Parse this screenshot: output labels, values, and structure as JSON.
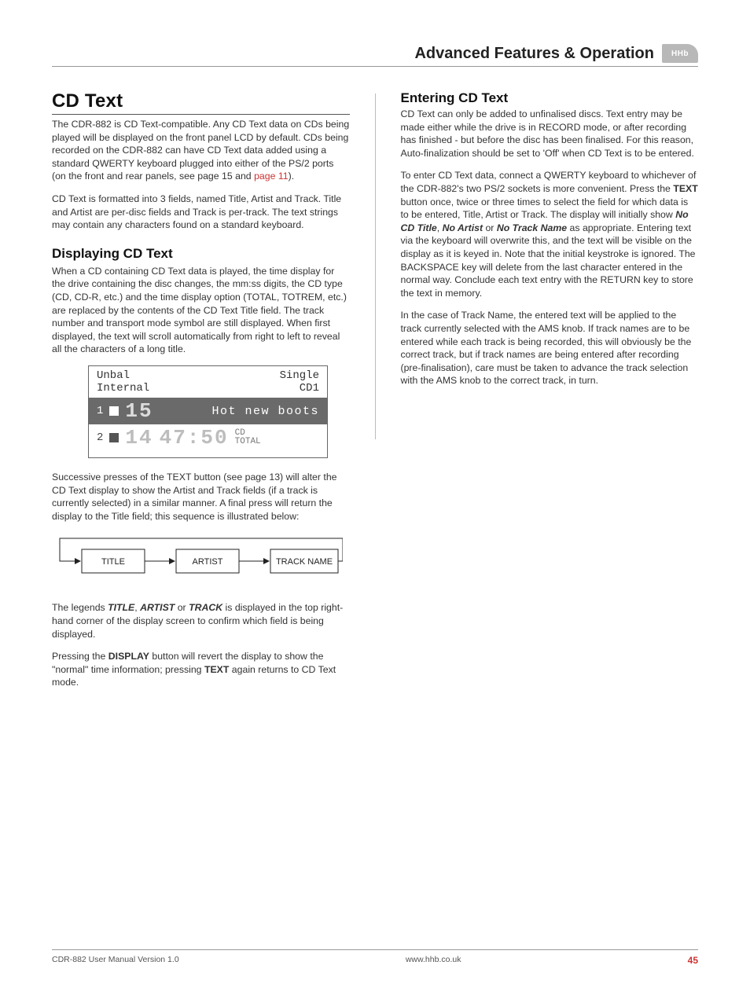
{
  "banner": {
    "title": "Advanced Features & Operation",
    "logo": "HHb"
  },
  "left": {
    "h1": "CD Text",
    "p1a": "The CDR-882 is CD Text-compatible. Any CD Text data on CDs being played will be displayed on the front panel LCD by default. CDs being recorded on the CDR-882 can have CD Text data added using a standard QWERTY keyboard plugged into either of the PS/2 ports (on the front and rear panels, see page 15 and ",
    "p1link": "page 11",
    "p1b": ").",
    "p2": "CD Text is formatted into 3 fields, named Title, Artist and Track. Title and Artist are per-disc fields and Track is per-track. The text strings may contain any characters found on a standard keyboard.",
    "h2a": "Displaying CD Text",
    "p3": "When a CD containing CD Text data is played, the time display for the drive containing the disc changes, the mm:ss digits, the CD type (CD, CD-R, etc.) and the time display option (TOTAL, TOTREM, etc.) are replaced by the contents of the CD Text Title field. The track number and transport mode symbol are still displayed. When first displayed, the text will scroll automatically from right to left to reveal all the characters of a long title.",
    "lcd": {
      "topLeft": "Unbal\nInternal",
      "topRight": "Single\nCD1",
      "row1_num": "1",
      "row1_big": "15",
      "row1_title": "Hot new boots",
      "row2_num": "2",
      "row2_big": "14",
      "row2_time": "47:50",
      "row2_meta": "CD\nTOTAL"
    },
    "p4": "Successive presses of the TEXT button (see page 13) will alter the CD Text display to show the Artist and Track fields (if a track is currently selected) in a similar manner. A final press will return the display to the Title field; this sequence is illustrated below:",
    "flow": {
      "b1": "TITLE",
      "b2": "ARTIST",
      "b3": "TRACK NAME"
    },
    "p5a": "The legends ",
    "p5b1": "TITLE",
    "p5c": ", ",
    "p5b2": "ARTIST",
    "p5d": " or ",
    "p5b3": "TRACK",
    "p5e": " is displayed in the top right-hand corner of the display screen to confirm which field is being displayed.",
    "p6a": "Pressing the ",
    "p6b1": "DISPLAY",
    "p6c": " button will revert the display to show the \"normal\" time information; pressing ",
    "p6b2": "TEXT",
    "p6d": " again returns to CD Text mode."
  },
  "right": {
    "h2": "Entering CD Text",
    "p1": "CD Text can only be added to unfinalised discs. Text entry may be made either while the drive is in RECORD mode, or after recording has finished - but before the disc has been finalised. For this reason,  Auto-finalization should be set to 'Off' when CD Text is to be entered.",
    "p2a": "To enter CD Text data, connect a QWERTY keyboard to whichever of the CDR-882's two PS/2 sockets is more convenient. Press the ",
    "p2b1": "TEXT",
    "p2b": " button once, twice or three times to select the field for which data is to be entered, Title, Artist or Track. The display will initially show ",
    "p2i1": "No CD Title",
    "p2c": ", ",
    "p2i2": "No Artist",
    "p2d": " or ",
    "p2i3": "No Track Name",
    "p2e": " as appropriate. Entering text via the keyboard will overwrite this, and the text will be visible on the display as it is keyed in. Note that the initial keystroke is ignored. The BACKSPACE key will delete from the last character entered in the normal way. Conclude each text entry with the RETURN key to store the text in memory.",
    "p3": "In the case of Track Name, the entered text will be applied to the track currently selected with the AMS knob. If track names are to be entered while each track is being recorded, this will obviously be the correct track, but if track names are being entered after recording (pre-finalisation), care must be taken to advance the track selection with the AMS knob to the correct track, in turn."
  },
  "footer": {
    "left": "CDR-882 User Manual Version 1.0",
    "center": "www.hhb.co.uk",
    "page": "45"
  }
}
